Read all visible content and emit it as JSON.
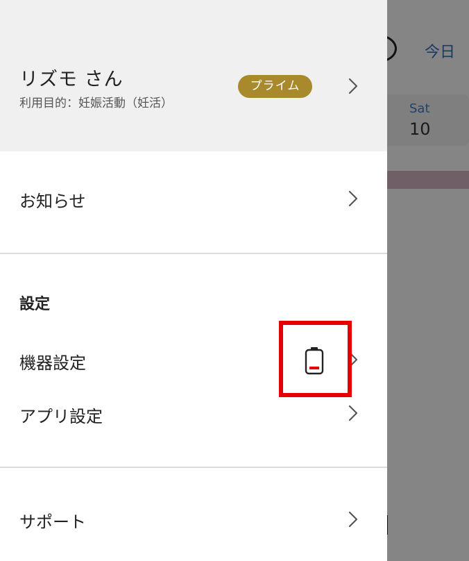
{
  "background_app": {
    "today_button": "今日",
    "weekday": "Sat",
    "date": "10"
  },
  "drawer": {
    "profile": {
      "name": "リズモ さん",
      "purpose": "利用目的：妊娠活動（妊活）",
      "badge": "プライム"
    },
    "notifications": {
      "label": "お知らせ"
    },
    "settings": {
      "title": "設定",
      "items": [
        {
          "label": "機器設定",
          "status_icon": "battery-low-icon"
        },
        {
          "label": "アプリ設定"
        }
      ]
    },
    "support": {
      "label": "サポート"
    }
  },
  "colors": {
    "badge_bg": "#a88a2c",
    "highlight": "#e60000",
    "battery_low": "#e60000",
    "link_blue": "#2f6fbd"
  }
}
